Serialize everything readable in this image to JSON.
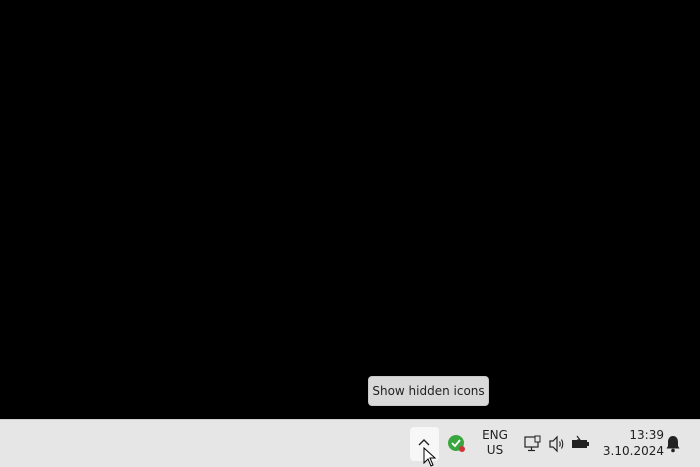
{
  "tooltip": {
    "text": "Show hidden icons"
  },
  "tray": {
    "show_hidden_icon": "chevron-up-icon",
    "security_icon": "shield-check-icon",
    "language": {
      "line1": "ENG",
      "line2": "US"
    },
    "network_icon": "network-icon",
    "volume_icon": "speaker-icon",
    "battery_icon": "battery-charging-icon",
    "notification_icon": "bell-icon"
  },
  "clock": {
    "time": "13:39",
    "date": "3.10.2024"
  },
  "colors": {
    "desktop": "#000000",
    "taskbar": "#e6e6e6",
    "security_green": "#3aa63f",
    "security_dot": "#d13438"
  }
}
